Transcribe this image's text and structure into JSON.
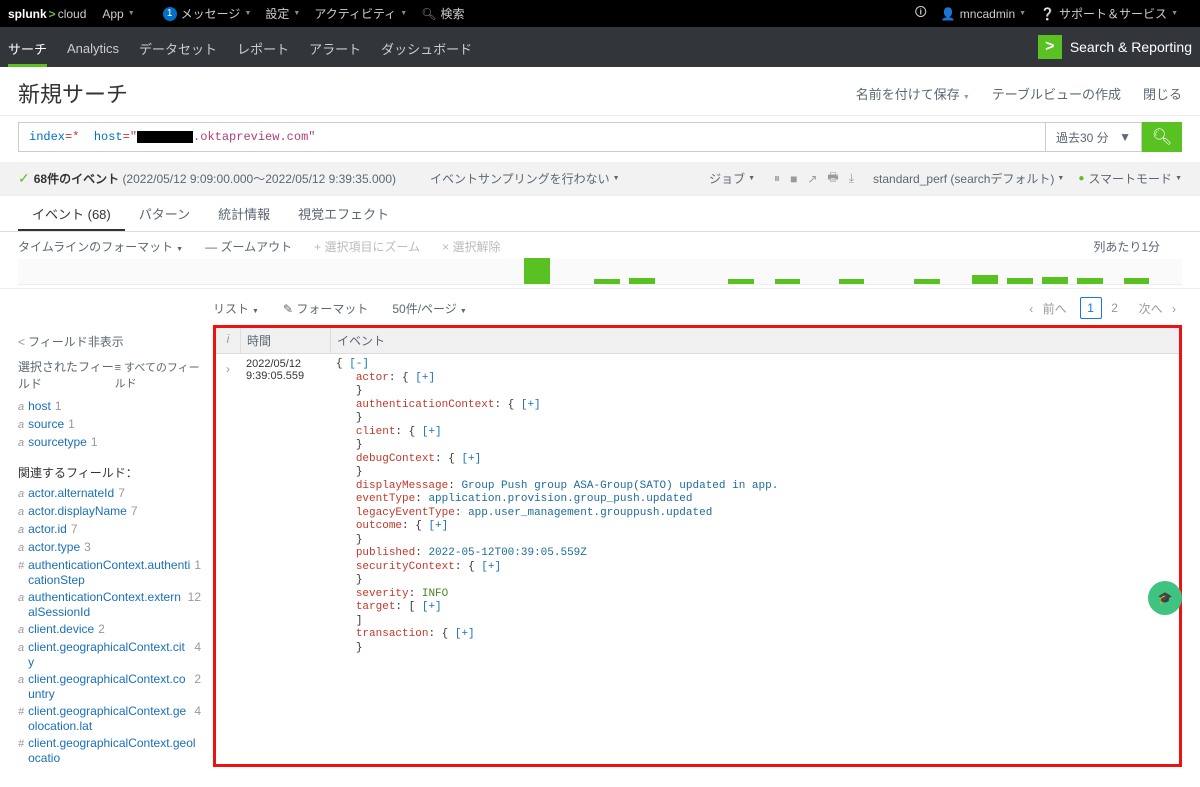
{
  "topbar": {
    "app": "App",
    "msg_count": "1",
    "msg_label": "メッセージ",
    "settings": "設定",
    "activity": "アクティビティ",
    "search_placeholder": "検索",
    "user": "mncadmin",
    "support": "サポート＆サービス"
  },
  "nav": {
    "tabs": [
      "サーチ",
      "Analytics",
      "データセット",
      "レポート",
      "アラート",
      "ダッシュボード"
    ],
    "brand": "Search & Reporting"
  },
  "title": {
    "heading": "新規サーチ",
    "save_as": "名前を付けて保存",
    "create_tv": "テーブルビューの作成",
    "close": "閉じる"
  },
  "search": {
    "kw1": "index",
    "kw2": "host",
    "hoststr_suffix": ".oktapreview.com\"",
    "time": "過去30 分"
  },
  "status": {
    "count_prefix": "68件のイベント",
    "range": "(2022/05/12 9:09:00.000～2022/05/12 9:39:35.000)",
    "sampling": "イベントサンプリングを行わない",
    "job": "ジョブ",
    "mode_label": "standard_perf (searchデフォルト)",
    "smart": "スマートモード"
  },
  "evtabs": [
    "イベント (68)",
    "パターン",
    "統計情報",
    "視覚エフェクト"
  ],
  "timeline": {
    "format": "タイムラインのフォーマット",
    "zoomout": "ズームアウト",
    "zoomsel": "選択項目にズーム",
    "clearsel": "選択解除",
    "per": "列あたり1分"
  },
  "listbar": {
    "list": "リスト",
    "format": "フォーマット",
    "perpage": "50件/ページ",
    "prev": "前へ",
    "pages": [
      "1",
      "2"
    ],
    "next": "次へ"
  },
  "sidebar": {
    "hide": "フィールド非表示",
    "selected": "選択されたフィールド",
    "allfields": "すべてのフィールド",
    "sel": [
      {
        "t": "a",
        "n": "host",
        "c": "1"
      },
      {
        "t": "a",
        "n": "source",
        "c": "1"
      },
      {
        "t": "a",
        "n": "sourcetype",
        "c": "1"
      }
    ],
    "related_label": "関連するフィールド：",
    "rel": [
      {
        "t": "a",
        "n": "actor.alternateId",
        "c": "7"
      },
      {
        "t": "a",
        "n": "actor.displayName",
        "c": "7"
      },
      {
        "t": "a",
        "n": "actor.id",
        "c": "7"
      },
      {
        "t": "a",
        "n": "actor.type",
        "c": "3"
      },
      {
        "t": "#",
        "n": "authenticationContext.authenticationStep",
        "c": "1"
      },
      {
        "t": "a",
        "n": "authenticationContext.externalSessionId",
        "c": "12"
      },
      {
        "t": "a",
        "n": "client.device",
        "c": "2"
      },
      {
        "t": "a",
        "n": "client.geographicalContext.city",
        "c": "4"
      },
      {
        "t": "a",
        "n": "client.geographicalContext.country",
        "c": "2"
      },
      {
        "t": "#",
        "n": "client.geographicalContext.geolocation.lat",
        "c": "4"
      },
      {
        "t": "#",
        "n": "client.geographicalContext.geolocatio",
        "c": ""
      }
    ]
  },
  "table": {
    "h_i": "i",
    "h_time": "時間",
    "h_event": "イベント",
    "ts_date": "2022/05/12",
    "ts_time": "9:39:05.559",
    "ev": {
      "actor": "actor",
      "authctx": "authenticationContext",
      "client": "client",
      "debugctx": "debugContext",
      "displayMessage": "displayMessage",
      "displayMessage_v": "Group Push group ASA-Group(SATO) updated in app.",
      "eventType": "eventType",
      "eventType_v": "application.provision.group_push.updated",
      "legacyEventType": "legacyEventType",
      "legacyEventType_v": "app.user_management.grouppush.updated",
      "outcome": "outcome",
      "published": "published",
      "published_v": "2022-05-12T00:39:05.559Z",
      "securityContext": "securityContext",
      "severity": "severity",
      "severity_v": "INFO",
      "target": "target",
      "transaction": "transaction",
      "open": "{ ",
      "close": "}",
      "collapse": "[-]",
      "expand": "[+]",
      "arrclose": "]"
    }
  }
}
